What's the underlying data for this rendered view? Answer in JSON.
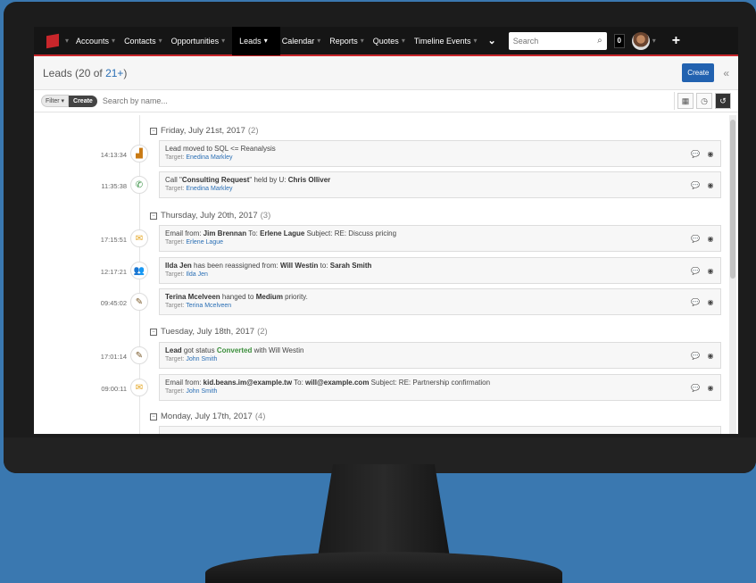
{
  "nav": {
    "items": [
      {
        "label": "Accounts"
      },
      {
        "label": "Contacts"
      },
      {
        "label": "Opportunities"
      },
      {
        "label": "Leads",
        "active": true
      },
      {
        "label": "Calendar"
      },
      {
        "label": "Reports"
      },
      {
        "label": "Quotes"
      },
      {
        "label": "Timeline Events"
      }
    ],
    "search_placeholder": "Search",
    "notification_count": "0"
  },
  "header": {
    "title": "Leads (20 of ",
    "count": "21+",
    "close": ")",
    "create_label": "Create"
  },
  "filter": {
    "filter_label": "Filter",
    "create_label": "Create",
    "search_placeholder": "Search by name..."
  },
  "timeline": {
    "groups": [
      {
        "date": "Friday, July 21st, 2017",
        "count": "(2)"
      },
      {
        "date": "Thursday, July 20th, 2017",
        "count": "(3)"
      },
      {
        "date": "Tuesday, July 18th, 2017",
        "count": "(2)"
      },
      {
        "date": "Monday, July 17th, 2017",
        "count": "(4)"
      }
    ],
    "events": [
      {
        "time": "14:13:34",
        "icon": "chart-icon",
        "pre": "Lead moved to SQL <= Reanalysis",
        "target": "Enedina Markley"
      },
      {
        "time": "11:35:38",
        "icon": "phone-icon",
        "pre": "Call \"",
        "bold": "Consulting Request",
        "post": "\" held by U: ",
        "bold2": "Chris Olliver",
        "target": "Enedina Markley"
      },
      {
        "time": "17:15:51",
        "icon": "email-icon",
        "pre": "Email from: ",
        "bold": "Jim Brennan",
        "post": " To: ",
        "bold2": "Erlene Lague",
        "post2": " Subject: RE: Discuss pricing",
        "target": "Erlene Lague"
      },
      {
        "time": "12:17:21",
        "icon": "users-icon",
        "bold": "Ilda Jen",
        "post": " has been reassigned from: ",
        "bold2": "Will Westin",
        "post2": " to: ",
        "bold3": "Sarah Smith",
        "target": "Ilda Jen"
      },
      {
        "time": "09:45:02",
        "icon": "edit-icon",
        "bold": "Terina Mcelveen",
        "post": " hanged to ",
        "bold2": "Medium",
        "post2": " priority.",
        "target": "Terina Mcelveen"
      },
      {
        "time": "17:01:14",
        "icon": "edit-icon",
        "pre": "Lead",
        "post": " got status ",
        "bold2": "Converted",
        "post2": " with Will Westin",
        "target": "John Smith"
      },
      {
        "time": "09:00:11",
        "icon": "email-icon",
        "pre": "Email from: ",
        "bold": "kid.beans.im@example.tw",
        "post": " To: ",
        "bold2": "will@example.com",
        "post2": " Subject: RE: Partnership confirmation",
        "target": "John Smith"
      }
    ],
    "target_prefix": "Target: "
  }
}
